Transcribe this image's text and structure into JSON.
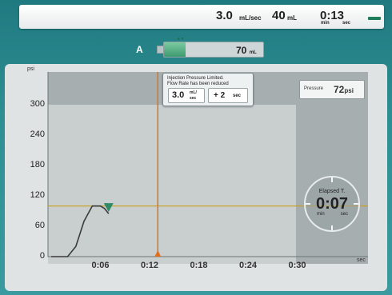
{
  "status_bar": {
    "flow_rate": "3.0",
    "flow_rate_unit": "mL/sec",
    "volume": "40",
    "volume_unit": "mL",
    "time": "0:13",
    "time_min_label": "min",
    "time_sec_label": "sec"
  },
  "syringe": {
    "label": "A",
    "volume": "70",
    "volume_unit": "mL",
    "fill_fraction": 0.22,
    "colors": {
      "fluid": "#4fae80"
    }
  },
  "graph": {
    "y_unit": "psi",
    "x_unit": "sec",
    "y_ticks": [
      "300",
      "240",
      "180",
      "120",
      "60",
      "0"
    ],
    "x_ticks": [
      "0:06",
      "0:12",
      "0:18",
      "0:24",
      "0:30"
    ]
  },
  "alert": {
    "message_line1": "Injection Pressure Limited.",
    "message_line2": "Flow Rate has been reduced",
    "rate_value": "3.0",
    "rate_unit_top": "mL/",
    "rate_unit_bottom": "sec",
    "time_value": "+ 2",
    "time_unit": "sec"
  },
  "pressure_readout": {
    "label": "Pressure",
    "value": "72",
    "unit": "psi"
  },
  "elapsed": {
    "label": "Elapsed T.",
    "value": "0:07",
    "min_label": "min",
    "sec_label": "sec"
  },
  "colors": {
    "cursor_line": "#e0701f",
    "limit_line": "#c9a020",
    "pressure_curve": "#3a3a3a",
    "marker": "#2f8a66"
  },
  "chart_data": {
    "type": "line",
    "x_unit": "sec",
    "y_unit": "psi",
    "xlim": [
      0,
      38
    ],
    "ylim": [
      0,
      330
    ],
    "y_ticks": [
      0,
      60,
      120,
      180,
      240,
      300
    ],
    "x_ticks": [
      6,
      12,
      18,
      24,
      30
    ],
    "series": [
      {
        "x": [
          0,
          2,
          3,
          4,
          5,
          6,
          6.5,
          7
        ],
        "y": [
          0,
          0,
          20,
          70,
          100,
          100,
          95,
          85
        ]
      }
    ],
    "pressure_limit": 100,
    "current_time": 13
  }
}
